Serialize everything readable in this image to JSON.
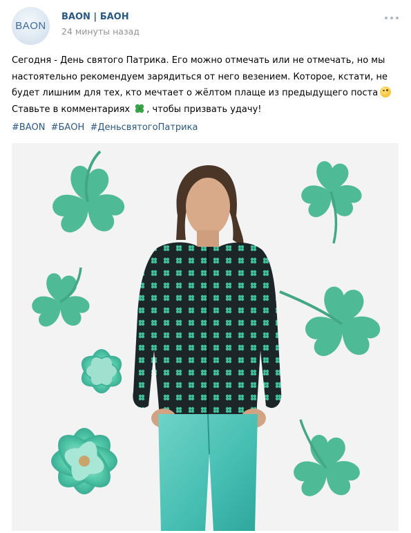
{
  "post": {
    "author": "BAON | БАОН",
    "avatar_logo": "BAON",
    "time": "24 минуты назад",
    "more_icon": "more-horizontal-icon",
    "text_lines": [
      "Сегодня - День святого Патрика. Его можно отмечать или не отмечать, но мы",
      "настоятельно рекомендуем зарядиться от него везением. Которое, кстати, не",
      "будет лишним для тех, кто мечтает о жёлтом плаще из предыдущего поста",
      "Ставьте в комментариях",
      ", чтобы призвать удачу!"
    ],
    "hashtags": [
      "#BAON",
      "#БАОН",
      "#ДеньсвятогоПатрика"
    ],
    "link_color": "#2a5885",
    "time_color": "#939393"
  },
  "photo": {
    "background": "#f3f3f3",
    "clover_color": "#3bb58c",
    "jacket_color": "#1e2a2c",
    "jeans_color": "#4fc3b8"
  }
}
